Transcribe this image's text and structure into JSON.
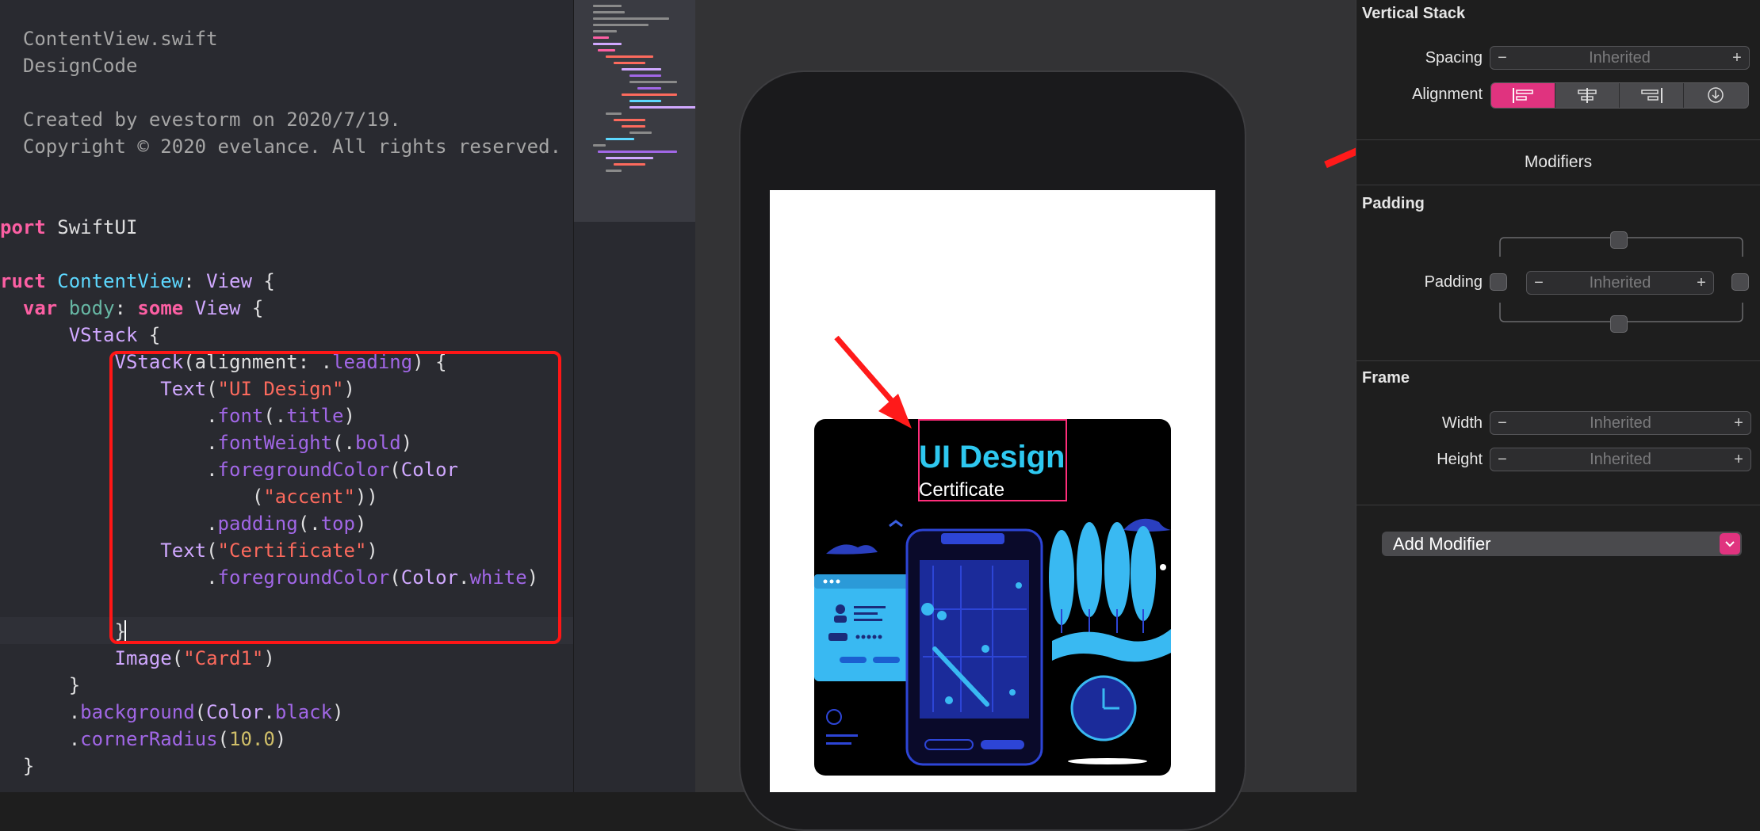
{
  "editor": {
    "lines": [
      [
        {
          "t": "  ContentView.swift",
          "c": "cmt"
        }
      ],
      [
        {
          "t": "  DesignCode",
          "c": "cmt"
        }
      ],
      [],
      [
        {
          "t": "  Created by evestorm on 2020/7/19.",
          "c": "cmt"
        }
      ],
      [
        {
          "t": "  Copyright © 2020 evelance. All rights reserved.",
          "c": "cmt"
        }
      ],
      [],
      [],
      [
        {
          "t": "port",
          "c": "kw"
        },
        {
          "t": " SwiftUI",
          "c": ""
        }
      ],
      [],
      [
        {
          "t": "ruct",
          "c": "kw"
        },
        {
          "t": " ",
          "c": ""
        },
        {
          "t": "ContentView",
          "c": "ty"
        },
        {
          "t": ": ",
          "c": ""
        },
        {
          "t": "View",
          "c": "tyu"
        },
        {
          "t": " {",
          "c": ""
        }
      ],
      [
        {
          "t": "  ",
          "c": ""
        },
        {
          "t": "var",
          "c": "kw"
        },
        {
          "t": " ",
          "c": ""
        },
        {
          "t": "body",
          "c": "ident"
        },
        {
          "t": ": ",
          "c": ""
        },
        {
          "t": "some",
          "c": "kw"
        },
        {
          "t": " ",
          "c": ""
        },
        {
          "t": "View",
          "c": "tyu"
        },
        {
          "t": " {",
          "c": ""
        }
      ],
      [
        {
          "t": "      ",
          "c": ""
        },
        {
          "t": "VStack",
          "c": "tyu"
        },
        {
          "t": " {",
          "c": ""
        }
      ],
      [
        {
          "t": "          ",
          "c": ""
        },
        {
          "t": "VStack",
          "c": "tyu"
        },
        {
          "t": "(alignment: .",
          "c": ""
        },
        {
          "t": "leading",
          "c": "fn"
        },
        {
          "t": ") {",
          "c": ""
        }
      ],
      [
        {
          "t": "              ",
          "c": ""
        },
        {
          "t": "Text",
          "c": "tyu"
        },
        {
          "t": "(",
          "c": ""
        },
        {
          "t": "\"UI Design\"",
          "c": "str"
        },
        {
          "t": ")",
          "c": ""
        }
      ],
      [
        {
          "t": "                  .",
          "c": ""
        },
        {
          "t": "font",
          "c": "fn"
        },
        {
          "t": "(.",
          "c": ""
        },
        {
          "t": "title",
          "c": "fn"
        },
        {
          "t": ")",
          "c": ""
        }
      ],
      [
        {
          "t": "                  .",
          "c": ""
        },
        {
          "t": "fontWeight",
          "c": "fn"
        },
        {
          "t": "(.",
          "c": ""
        },
        {
          "t": "bold",
          "c": "fn"
        },
        {
          "t": ")",
          "c": ""
        }
      ],
      [
        {
          "t": "                  .",
          "c": ""
        },
        {
          "t": "foregroundColor",
          "c": "fn"
        },
        {
          "t": "(",
          "c": ""
        },
        {
          "t": "Color",
          "c": "tyu"
        }
      ],
      [
        {
          "t": "                      (",
          "c": ""
        },
        {
          "t": "\"accent\"",
          "c": "str"
        },
        {
          "t": "))",
          "c": ""
        }
      ],
      [
        {
          "t": "                  .",
          "c": ""
        },
        {
          "t": "padding",
          "c": "fn"
        },
        {
          "t": "(.",
          "c": ""
        },
        {
          "t": "top",
          "c": "fn"
        },
        {
          "t": ")",
          "c": ""
        }
      ],
      [
        {
          "t": "              ",
          "c": ""
        },
        {
          "t": "Text",
          "c": "tyu"
        },
        {
          "t": "(",
          "c": ""
        },
        {
          "t": "\"Certificate\"",
          "c": "str"
        },
        {
          "t": ")",
          "c": ""
        }
      ],
      [
        {
          "t": "                  .",
          "c": ""
        },
        {
          "t": "foregroundColor",
          "c": "fn"
        },
        {
          "t": "(",
          "c": ""
        },
        {
          "t": "Color",
          "c": "tyu"
        },
        {
          "t": ".",
          "c": ""
        },
        {
          "t": "white",
          "c": "fn"
        },
        {
          "t": ")",
          "c": ""
        }
      ],
      [],
      [
        {
          "t": "          }",
          "c": ""
        }
      ],
      [
        {
          "t": "          ",
          "c": ""
        },
        {
          "t": "Image",
          "c": "tyu"
        },
        {
          "t": "(",
          "c": ""
        },
        {
          "t": "\"Card1\"",
          "c": "str"
        },
        {
          "t": ")",
          "c": ""
        }
      ],
      [
        {
          "t": "      }",
          "c": ""
        }
      ],
      [
        {
          "t": "      .",
          "c": ""
        },
        {
          "t": "background",
          "c": "fn"
        },
        {
          "t": "(",
          "c": ""
        },
        {
          "t": "Color",
          "c": "tyu"
        },
        {
          "t": ".",
          "c": ""
        },
        {
          "t": "black",
          "c": "fn"
        },
        {
          "t": ")",
          "c": ""
        }
      ],
      [
        {
          "t": "      .",
          "c": ""
        },
        {
          "t": "cornerRadius",
          "c": "fn"
        },
        {
          "t": "(",
          "c": ""
        },
        {
          "t": "10.0",
          "c": "num"
        },
        {
          "t": ")",
          "c": ""
        }
      ],
      [
        {
          "t": "  }",
          "c": ""
        }
      ]
    ]
  },
  "preview": {
    "title": "UI Design",
    "subtitle": "Certificate",
    "accent_color": "#2ec8f0",
    "selection_color": "#ff2d7a"
  },
  "inspector": {
    "vstack_title": "Vertical Stack",
    "spacing_label": "Spacing",
    "spacing_value": "Inherited",
    "alignment_label": "Alignment",
    "alignment_options": [
      "leading",
      "center",
      "trailing",
      "inherited"
    ],
    "alignment_selected": "leading",
    "modifiers_title": "Modifiers",
    "padding_title": "Padding",
    "padding_label": "Padding",
    "padding_value": "Inherited",
    "frame_title": "Frame",
    "width_label": "Width",
    "width_value": "Inherited",
    "height_label": "Height",
    "height_value": "Inherited",
    "add_modifier_label": "Add Modifier",
    "minus": "−",
    "plus": "+",
    "accent_color": "#e0337f"
  },
  "annotations": {
    "arrow_color": "#ff1a1a"
  }
}
